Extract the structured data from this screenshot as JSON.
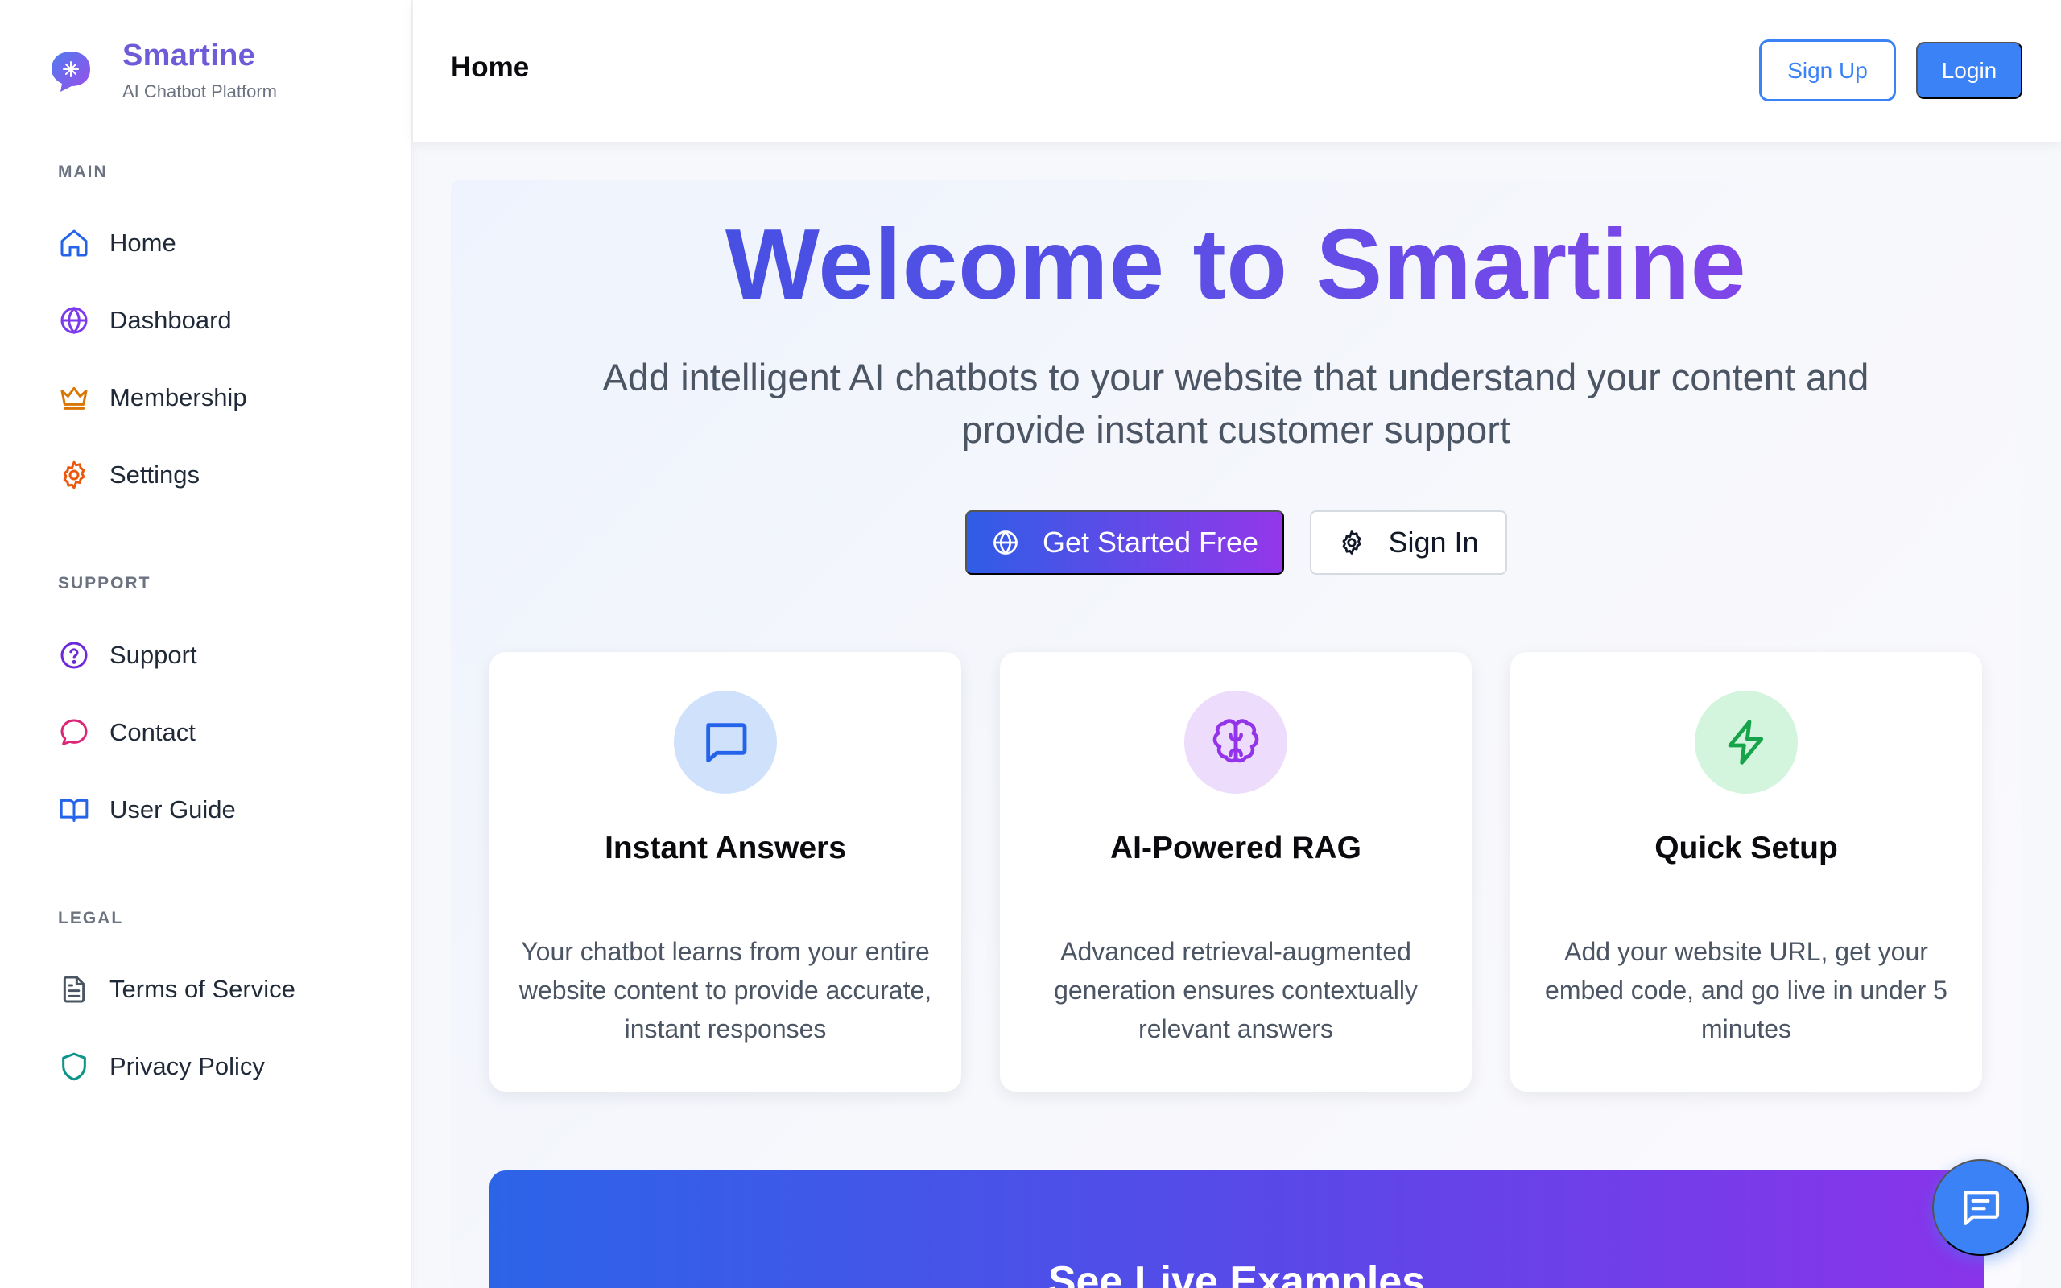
{
  "brand": {
    "name": "Smartine",
    "subtitle": "AI Chatbot Platform"
  },
  "sidebar": {
    "sections": [
      {
        "label": "MAIN",
        "items": [
          {
            "label": "Home",
            "icon": "home-icon",
            "color": "#2563eb"
          },
          {
            "label": "Dashboard",
            "icon": "globe-icon",
            "color": "#7c3aed"
          },
          {
            "label": "Membership",
            "icon": "crown-icon",
            "color": "#d97706"
          },
          {
            "label": "Settings",
            "icon": "gear-icon",
            "color": "#ea580c"
          }
        ]
      },
      {
        "label": "SUPPORT",
        "items": [
          {
            "label": "Support",
            "icon": "help-circle-icon",
            "color": "#6d28d9"
          },
          {
            "label": "Contact",
            "icon": "chat-bubble-icon",
            "color": "#db2777"
          },
          {
            "label": "User Guide",
            "icon": "book-icon",
            "color": "#2563eb"
          }
        ]
      },
      {
        "label": "LEGAL",
        "items": [
          {
            "label": "Terms of Service",
            "icon": "document-icon",
            "color": "#4b5563"
          },
          {
            "label": "Privacy Policy",
            "icon": "shield-icon",
            "color": "#0d9488"
          }
        ]
      }
    ]
  },
  "header": {
    "title": "Home",
    "signup_label": "Sign Up",
    "login_label": "Login"
  },
  "hero": {
    "title": "Welcome to Smartine",
    "subtitle": "Add intelligent AI chatbots to your website that understand your content and provide instant customer support",
    "primary_cta": "Get Started Free",
    "secondary_cta": "Sign In"
  },
  "features": [
    {
      "title": "Instant Answers",
      "description": "Your chatbot learns from your entire website content to provide accurate, instant responses",
      "icon": "message-square-icon",
      "icon_bg": "#cfe1fb",
      "icon_color": "#2563eb"
    },
    {
      "title": "AI-Powered RAG",
      "description": "Advanced retrieval-augmented generation ensures contextually relevant answers",
      "icon": "brain-icon",
      "icon_bg": "#eddcfb",
      "icon_color": "#9333ea"
    },
    {
      "title": "Quick Setup",
      "description": "Add your website URL, get your embed code, and go live in under 5 minutes",
      "icon": "lightning-icon",
      "icon_bg": "#d3f5de",
      "icon_color": "#16a34a"
    }
  ],
  "live_examples": {
    "title": "See Live Examples"
  },
  "colors": {
    "accent": "#3b82f6",
    "brand": "#6d5bd8",
    "gradient_start": "#2f5de6",
    "gradient_end": "#9337ea"
  }
}
